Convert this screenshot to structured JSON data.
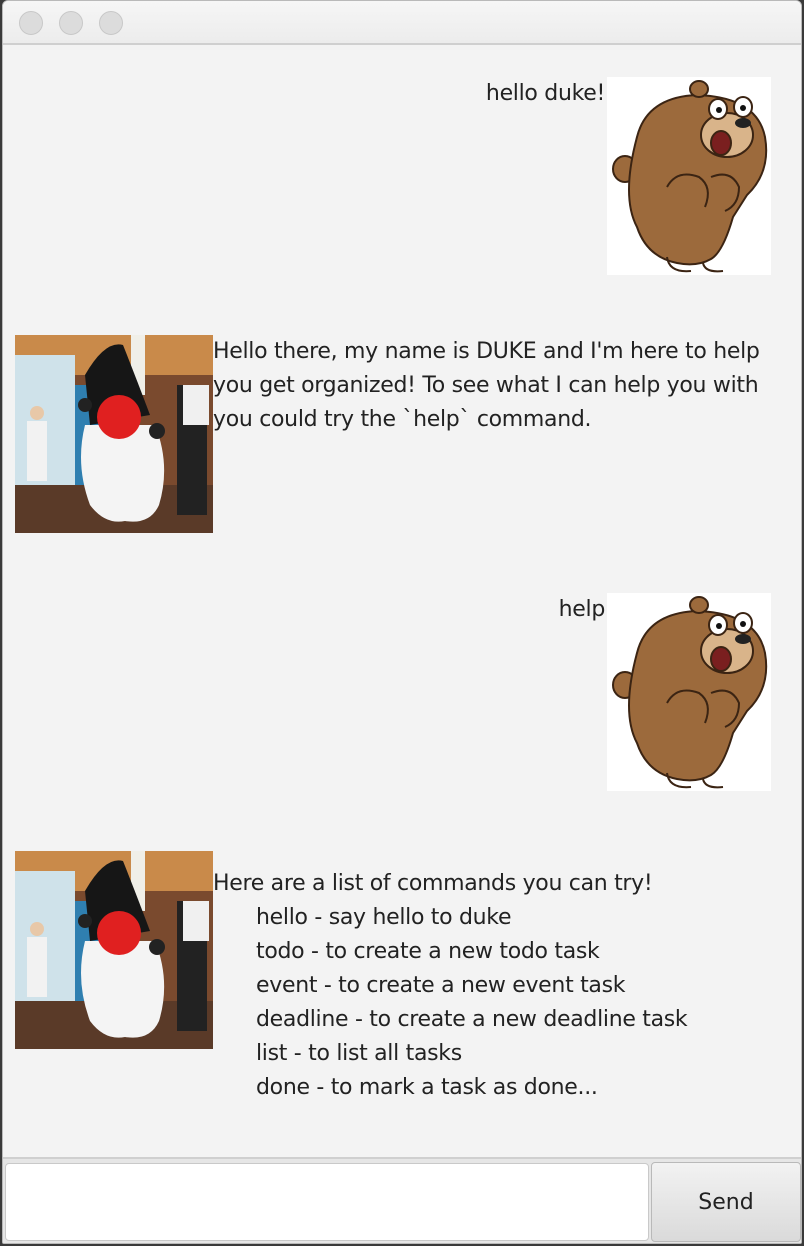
{
  "window": {
    "title": ""
  },
  "messages": [
    {
      "sender": "user",
      "text": "hello duke!"
    },
    {
      "sender": "duke",
      "lines": [
        "Hello there, my name is DUKE and I'm here to help",
        "you get organized! To see what I can help you with",
        "you could try the `help` command."
      ]
    },
    {
      "sender": "user",
      "text": "help"
    },
    {
      "sender": "duke",
      "intro": "Here are a list of commands you can try!",
      "commands": [
        "hello - say hello to duke",
        "todo - to create a new todo task",
        "event - to create a new event task",
        "deadline - to create a new deadline task",
        "list - to list all tasks",
        "done - to mark a task as done..."
      ]
    }
  ],
  "input": {
    "value": "",
    "placeholder": ""
  },
  "send_button": {
    "label": "Send"
  },
  "colors": {
    "background": "#f3f3f3",
    "text": "#222222",
    "bear": "#9c6a3c",
    "duke_nose": "#e02020"
  },
  "icons": {
    "user_avatar": "bear-avatar-icon",
    "duke_avatar": "duke-mascot-avatar-icon"
  }
}
